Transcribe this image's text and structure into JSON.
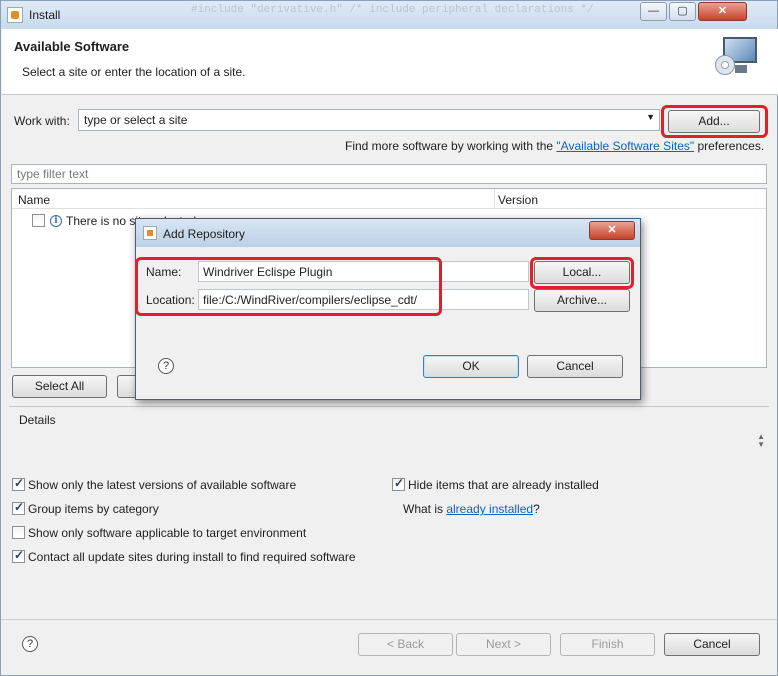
{
  "window": {
    "title": "Install",
    "background_code_text": "#include \"derivative.h\" /* include peripheral declarations */",
    "minimize_label": "—",
    "maximize_label": "▢",
    "close_label": "✕"
  },
  "header": {
    "title": "Available Software",
    "subtitle": "Select a site or enter the location of a site."
  },
  "work_with": {
    "label": "Work with:",
    "placeholder": "type or select a site",
    "add_button": "Add...",
    "find_more_prefix": "Find more software by working with the ",
    "find_more_link": "\"Available Software Sites\"",
    "find_more_suffix": " preferences."
  },
  "filter": {
    "placeholder": "type filter text"
  },
  "table": {
    "columns": [
      "Name",
      "Version"
    ],
    "rows": [
      {
        "name": "There is no site selected.",
        "checked": false
      }
    ]
  },
  "table_buttons": {
    "select_all": "Select All"
  },
  "details": {
    "title": "Details"
  },
  "options": {
    "show_latest": {
      "label": "Show only the latest versions of available software",
      "checked": true
    },
    "group_by_category": {
      "label": "Group items by category",
      "checked": true
    },
    "show_applicable": {
      "label": "Show only software applicable to target environment",
      "checked": false
    },
    "contact_all_sites": {
      "label": "Contact all update sites during install to find required software",
      "checked": true
    },
    "hide_installed": {
      "label": "Hide items that are already installed",
      "checked": true
    },
    "what_is_prefix": "What is ",
    "what_is_link": "already installed",
    "what_is_suffix": "?"
  },
  "footer": {
    "help": "?",
    "back": "< Back",
    "next": "Next >",
    "finish": "Finish",
    "cancel": "Cancel"
  },
  "dialog": {
    "title": "Add Repository",
    "close_label": "✕",
    "name_label": "Name:",
    "name_value": "Windriver Eclispe Plugin",
    "location_label": "Location:",
    "location_value": "file:/C:/WindRiver/compilers/eclipse_cdt/",
    "local_button": "Local...",
    "archive_button": "Archive...",
    "help": "?",
    "ok_button": "OK",
    "cancel_button": "Cancel"
  },
  "colors": {
    "highlight": "#e0202a",
    "link": "#0066cc"
  }
}
